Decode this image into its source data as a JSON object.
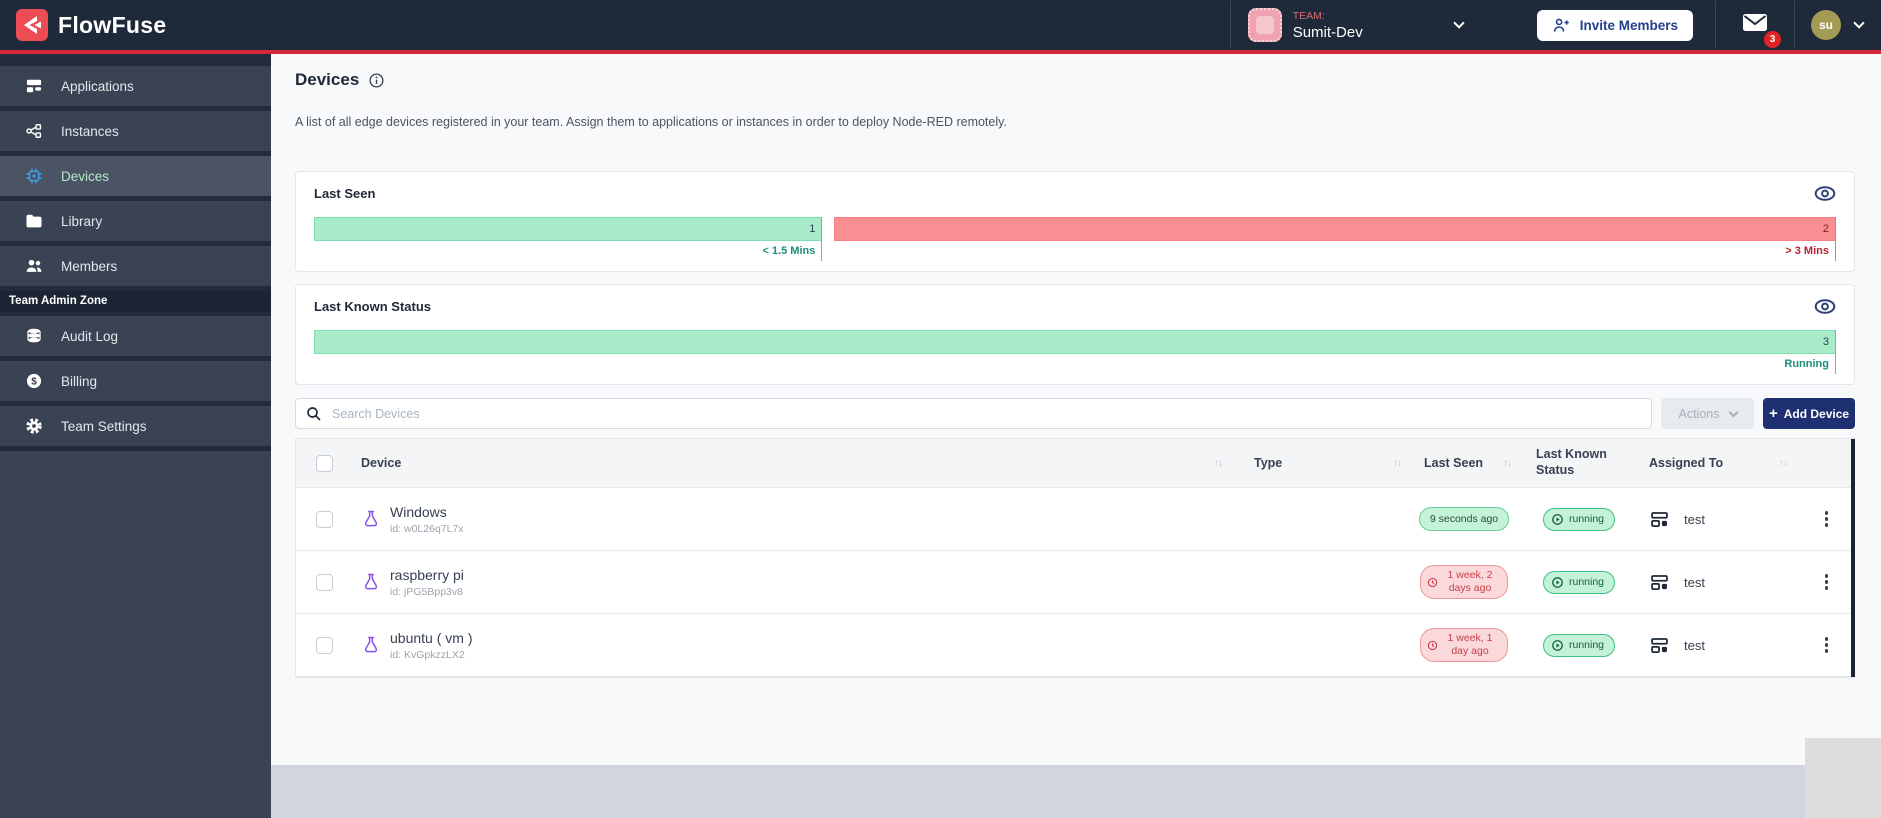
{
  "colors": {
    "header_bg": "#1E2A3A",
    "accent_red": "#D5293B",
    "brand_red": "#EE4C55",
    "primary_button_navy": "#1E2F72",
    "chart_green_fill": "#A9ECCA",
    "chart_red_fill": "#FA8F93",
    "active_item_icon_blue": "#41A0E8",
    "device_flask_purple": "#8A53E8"
  },
  "header": {
    "brand": "FlowFuse",
    "team_label": "TEAM:",
    "team_name": "Sumit-Dev",
    "invite_members_label": "Invite Members",
    "mail_badge_count": "3",
    "avatar_initials": "su"
  },
  "sidebar": {
    "items": [
      {
        "label": "Applications"
      },
      {
        "label": "Instances"
      },
      {
        "label": "Devices"
      },
      {
        "label": "Library"
      },
      {
        "label": "Members"
      }
    ],
    "admin_zone_label": "Team Admin Zone",
    "admin_items": [
      {
        "label": "Audit Log"
      },
      {
        "label": "Billing"
      },
      {
        "label": "Team Settings"
      }
    ]
  },
  "page": {
    "title": "Devices",
    "description": "A list of all edge devices registered in your team. Assign them to applications or instances in order to deploy Node-RED remotely."
  },
  "charts": [
    {
      "type": "bar",
      "title": "Last Seen",
      "segments": [
        {
          "count": 1,
          "label": "< 1.5 Mins",
          "color": "green"
        },
        {
          "count": 2,
          "label": "> 3 Mins",
          "color": "red"
        }
      ]
    },
    {
      "type": "bar",
      "title": "Last Known Status",
      "segments": [
        {
          "count": 3,
          "label": "Running",
          "color": "green"
        }
      ]
    }
  ],
  "toolbar": {
    "search_placeholder": "Search Devices",
    "actions_label": "Actions",
    "add_device_label": "Add Device",
    "add_icon": "+"
  },
  "table": {
    "sort_icon": "↑↓",
    "columns": [
      "Device",
      "Type",
      "Last Seen",
      "Last Known Status",
      "Assigned To"
    ],
    "rows": [
      {
        "name": "Windows",
        "id": "id: w0L26q7L7x",
        "type": "",
        "last_seen": "9 seconds ago",
        "seen_state": "ok",
        "status": "running",
        "assigned_to": "test"
      },
      {
        "name": "raspberry pi",
        "id": "id: jPG5Bpp3v8",
        "type": "",
        "last_seen": "1 week, 2 days ago",
        "seen_state": "stale",
        "status": "running",
        "assigned_to": "test"
      },
      {
        "name": "ubuntu ( vm )",
        "id": "id: KvGpkzzLX2",
        "type": "",
        "last_seen": "1 week, 1 day ago",
        "seen_state": "stale",
        "status": "running",
        "assigned_to": "test"
      }
    ]
  }
}
